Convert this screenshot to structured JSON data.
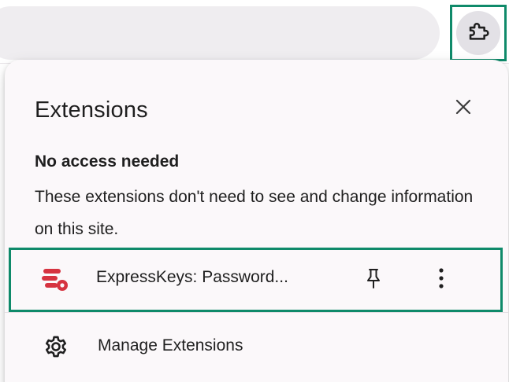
{
  "toolbar": {
    "extensions_button_icon": "puzzle-piece-icon"
  },
  "popup": {
    "title": "Extensions",
    "close_icon": "close-icon",
    "section": {
      "heading": "No access needed",
      "description": "These extensions don't need to see and change information on this site."
    },
    "extensions": [
      {
        "name": "ExpressKeys: Password...",
        "icon": "expresskeys-logo",
        "pin_icon": "pin-icon",
        "more_icon": "more-vertical-icon"
      }
    ],
    "manage": {
      "label": "Manage Extensions",
      "icon": "gear-icon"
    }
  },
  "colors": {
    "highlight": "#0f8a6a",
    "brand_red": "#d63340",
    "popup_bg": "#fbf8fa",
    "text": "#1f1f1f"
  }
}
